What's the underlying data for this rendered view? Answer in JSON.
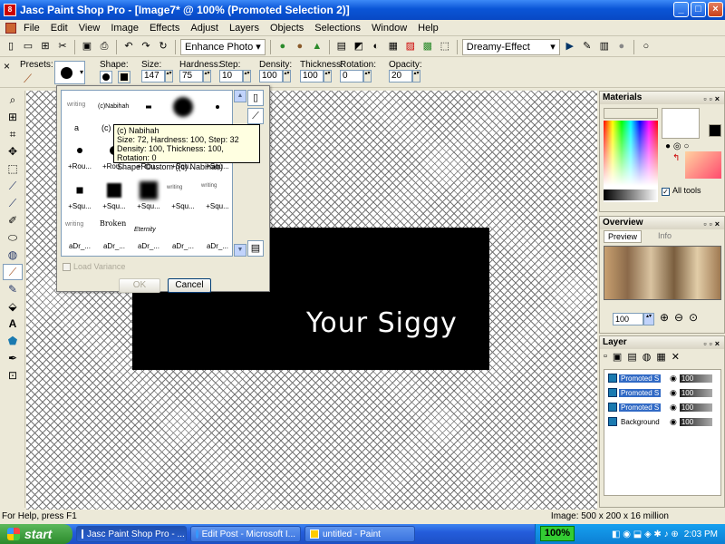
{
  "window": {
    "title": "Jasc Paint Shop Pro - [Image7* @ 100% (Promoted Selection 2)]",
    "app_badge": "8"
  },
  "menu": [
    "File",
    "Edit",
    "View",
    "Image",
    "Effects",
    "Adjust",
    "Layers",
    "Objects",
    "Selections",
    "Window",
    "Help"
  ],
  "toolbar": {
    "enhance_label": "Enhance Photo",
    "script_select": "Dreamy-Effect"
  },
  "options": {
    "presets_label": "Presets:",
    "shape_label": "Shape:",
    "size_label": "Size:",
    "size_value": "147",
    "hardness_label": "Hardness:",
    "hardness_value": "75",
    "step_label": "Step:",
    "step_value": "10",
    "density_label": "Density:",
    "density_value": "100",
    "thickness_label": "Thickness:",
    "thickness_value": "100",
    "rotation_label": "Rotation:",
    "rotation_value": "0",
    "opacity_label": "Opacity:",
    "opacity_value": "20"
  },
  "canvas": {
    "text": "Your Siggy"
  },
  "brush_dialog": {
    "brush_labels": [
      "",
      "",
      "",
      "",
      "",
      "(c) Nabihah",
      "",
      "",
      "+Rou...",
      "+Rou...",
      "+Rou...",
      "+Squ...",
      "+Squ...",
      "+Squ...",
      "+Squ...",
      "+Squ...",
      "aDr_...",
      "aDr_...",
      "aDr_...",
      "aDr_..."
    ],
    "tooltip_lines": [
      "(c) Nabihah",
      "Size: 72, Hardness: 100, Step: 32",
      "Density: 100, Thickness: 100, Rotation: 0",
      "Shape: Custom ((c) Nabihah)"
    ],
    "load_variance_label": "Load Variance",
    "ok_label": "OK",
    "cancel_label": "Cancel",
    "cell_text_a": "(c)Nabihah",
    "cell_text_b": "(c) N",
    "cell_text_c": "a",
    "cell_text_d": "Broken",
    "cell_text_e": "Eternity",
    "cell_text_f": "writing"
  },
  "materials": {
    "title": "Materials",
    "all_tools_label": "All tools"
  },
  "overview": {
    "title": "Overview",
    "tab_preview": "Preview",
    "tab_info": "Info",
    "zoom_value": "100"
  },
  "layers": {
    "title": "Layer",
    "items": [
      {
        "name": "Promoted S",
        "opacity": "100"
      },
      {
        "name": "Promoted S",
        "opacity": "100"
      },
      {
        "name": "Promoted S",
        "opacity": "100"
      },
      {
        "name": "Background",
        "opacity": "100"
      }
    ]
  },
  "status": {
    "help_text": "For Help, press F1",
    "image_info": "Image:  500 x 200 x 16 million"
  },
  "taskbar": {
    "start_label": "start",
    "tasks": [
      "Jasc Paint Shop Pro - ...",
      "Edit Post - Microsoft I...",
      "untitled - Paint"
    ],
    "zoom_badge": "100%",
    "clock": "2:03 PM"
  },
  "colors": {
    "accent": "#0a55d6",
    "canvas_image": "#000000"
  }
}
